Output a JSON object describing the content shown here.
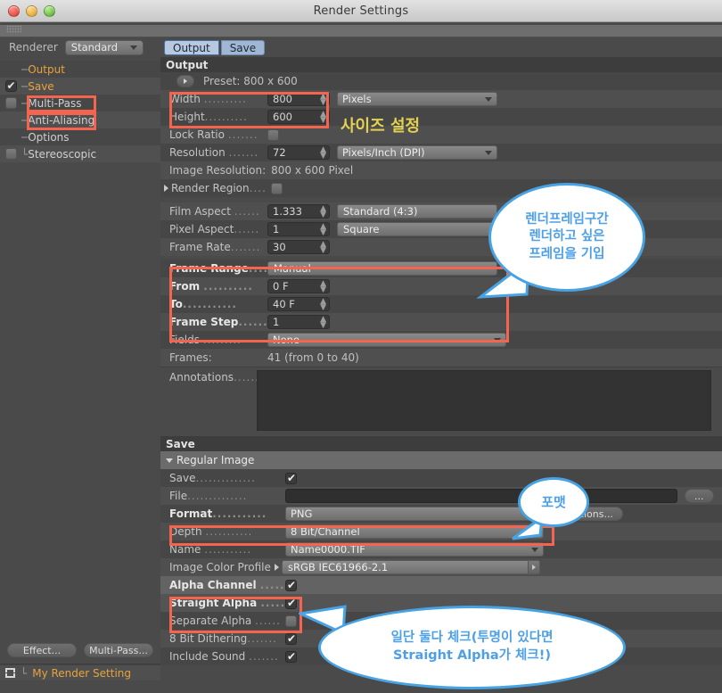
{
  "window": {
    "title": "Render Settings"
  },
  "sidebar": {
    "renderer_label": "Renderer",
    "renderer_value": "Standard",
    "items": [
      {
        "label": "Output",
        "checkbox": "none",
        "highlighted": true
      },
      {
        "label": "Save",
        "checkbox": "on",
        "highlighted": true
      },
      {
        "label": "Multi-Pass",
        "checkbox": "off",
        "highlighted": false
      },
      {
        "label": "Anti-Aliasing",
        "checkbox": "none",
        "highlighted": false
      },
      {
        "label": "Options",
        "checkbox": "none",
        "highlighted": false
      },
      {
        "label": "Stereoscopic",
        "checkbox": "off",
        "highlighted": false
      }
    ],
    "effect_button": "Effect...",
    "multipass_button": "Multi-Pass...",
    "render_setting_name": "My Render Setting"
  },
  "tabs": [
    {
      "label": "Output",
      "selected": true
    },
    {
      "label": "Save",
      "selected": false
    }
  ],
  "output": {
    "section_title": "Output",
    "preset_label": "Preset: 800 x 600",
    "width_label": "Width",
    "width_value": "800",
    "width_unit": "Pixels",
    "height_label": "Height",
    "height_value": "600",
    "lock_ratio_label": "Lock Ratio",
    "lock_ratio_checked": false,
    "resolution_label": "Resolution",
    "resolution_value": "72",
    "resolution_unit": "Pixels/Inch (DPI)",
    "image_resolution_label": "Image Resolution:",
    "image_resolution_value": "800 x 600 Pixel",
    "render_region_label": "Render Region",
    "render_region_checked": false,
    "film_aspect_label": "Film Aspect",
    "film_aspect_value": "1.333",
    "film_aspect_preset": "Standard (4:3)",
    "pixel_aspect_label": "Pixel Aspect",
    "pixel_aspect_value": "1",
    "pixel_aspect_preset": "Square",
    "frame_rate_label": "Frame Rate",
    "frame_rate_value": "30",
    "frame_range_label": "Frame Range",
    "frame_range_value": "Manual",
    "from_label": "From",
    "from_value": "0 F",
    "to_label": "To",
    "to_value": "40 F",
    "frame_step_label": "Frame Step",
    "frame_step_value": "1",
    "fields_label": "Fields",
    "fields_value": "None",
    "frames_label": "Frames:",
    "frames_value": "41 (from 0 to 40)",
    "annotations_label": "Annotations",
    "annotations_value": ""
  },
  "save": {
    "section_title": "Save",
    "regular_image_label": "Regular Image",
    "save_label": "Save",
    "save_checked": true,
    "file_label": "File",
    "file_value": "",
    "file_browse_button": "...",
    "format_label": "Format",
    "format_value": "PNG",
    "options_button": "Options...",
    "depth_label": "Depth",
    "depth_value": "8 Bit/Channel",
    "name_label": "Name",
    "name_value": "Name0000.TIF",
    "color_profile_label": "Image Color Profile",
    "color_profile_value": "sRGB IEC61966-2.1",
    "alpha_channel_label": "Alpha Channel",
    "alpha_channel_checked": true,
    "straight_alpha_label": "Straight Alpha",
    "straight_alpha_checked": true,
    "separate_alpha_label": "Separate Alpha",
    "separate_alpha_checked": false,
    "dithering_label": "8 Bit Dithering",
    "dithering_checked": true,
    "include_sound_label": "Include Sound",
    "include_sound_checked": true
  },
  "annotations": {
    "size_note": "사이즈 설정",
    "frame_note_line1": "렌더프레임구간",
    "frame_note_line2": "렌더하고 싶은",
    "frame_note_line3": "프레임을 기입",
    "format_note": "포맷",
    "alpha_note_line1": "일단 둘다 체크(투명이 있다면",
    "alpha_note_line2": "Straight Alpha가 체크!)"
  },
  "colors": {
    "highlight_red": "#f4644e",
    "bubble_blue": "#47a3e3",
    "note_yellow": "#e3d14f",
    "accent_orange": "#e8a33d"
  }
}
